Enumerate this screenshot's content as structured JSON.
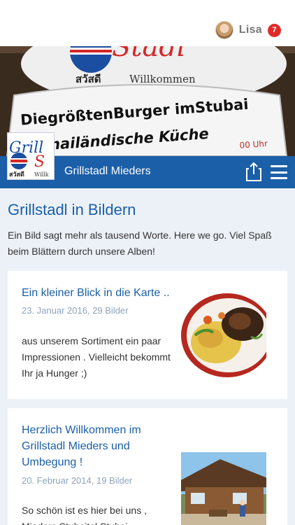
{
  "user": {
    "name": "Lisa",
    "notifications": "7"
  },
  "hero": {
    "sign_top": "Stadl",
    "sign_thai": "สวัสดี",
    "sign_welcome": "Willkommen",
    "line1": "DiegrößtenBurger imStubai",
    "line2": "Thailändische Küche",
    "hours": "00 Uhr"
  },
  "logo": {
    "text_top": "Grill",
    "text_s": "S",
    "text_thai": "สวัสดี",
    "text_welcome": "Willk"
  },
  "header": {
    "title": "Grillstadl Mieders"
  },
  "main": {
    "title": "Grillstadl in Bildern",
    "intro": "Ein Bild sagt mehr als tausend Worte. Here we go. Viel Spaß beim Blättern durch unsere Alben!"
  },
  "albums": [
    {
      "title": "Ein kleiner Blick in die Karte ..",
      "meta": "23. Januar 2016, 29 Bilder",
      "description": "aus unserem Sortiment ein paar Impressionen . Vielleicht bekommt Ihr ja Hunger ;)"
    },
    {
      "title": "Herzlich Willkommen im Grillstadl Mieders und Umbegung !",
      "meta": "20. Februar 2014, 19 Bilder",
      "description": "So schön ist es hier bei uns , Mieders Stubaital Stubai"
    }
  ],
  "icons": {
    "share": "share-icon",
    "menu": "hamburger-menu-icon"
  }
}
